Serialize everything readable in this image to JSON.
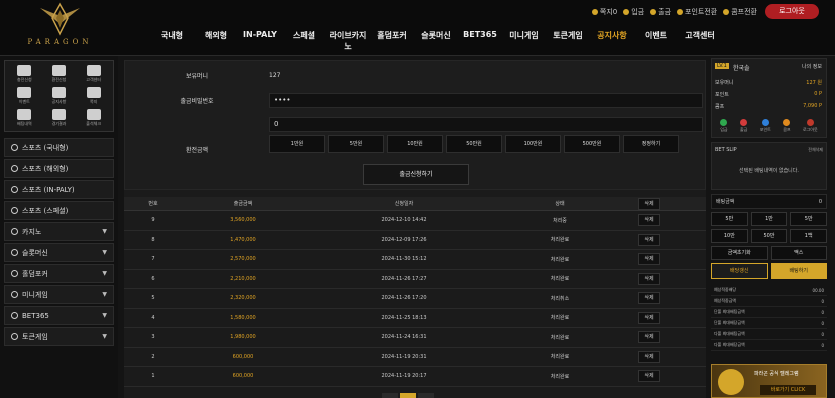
{
  "brand": {
    "logo_text": "PARAGON"
  },
  "top_links": [
    {
      "label": "쪽지0"
    },
    {
      "label": "입금"
    },
    {
      "label": "출금"
    },
    {
      "label": "포인트전환"
    },
    {
      "label": "콤프전환"
    }
  ],
  "logout_label": "로그아웃",
  "nav": [
    "국내형",
    "해외형",
    "IN-PALY",
    "스페셜",
    "라이브카지노",
    "홀덤포커",
    "슬롯머신",
    "BET365",
    "미니게임",
    "토큰게임",
    "공지사항",
    "이벤트",
    "고객센터"
  ],
  "nav_active_index": 10,
  "quick_menu": [
    "충전신청",
    "환전신청",
    "고객센터",
    "이벤트",
    "공지사항",
    "쪽지",
    "배팅내역",
    "경기결과",
    "출석체크"
  ],
  "side_menu": [
    {
      "label": "스포츠 (국내형)",
      "chevron": false
    },
    {
      "label": "스포츠 (해외형)",
      "chevron": false
    },
    {
      "label": "스포츠 (IN-PALY)",
      "chevron": false
    },
    {
      "label": "스포츠 (스페셜)",
      "chevron": false
    },
    {
      "label": "카지노",
      "chevron": true
    },
    {
      "label": "슬롯머신",
      "chevron": true
    },
    {
      "label": "홀덤포커",
      "chevron": true
    },
    {
      "label": "미니게임",
      "chevron": true
    },
    {
      "label": "BET365",
      "chevron": true
    },
    {
      "label": "토큰게임",
      "chevron": true
    }
  ],
  "form": {
    "balance_label": "보유머니",
    "balance_value": "127",
    "password_label": "출금비밀번호",
    "password_value": "••••",
    "amount_label": "환전금액",
    "amount_value": "0",
    "amount_buttons": [
      "1만원",
      "5만원",
      "10만원",
      "50만원",
      "100만원",
      "500만원",
      "정정하기"
    ],
    "submit_label": "출금신청하기"
  },
  "table": {
    "headers": [
      "번호",
      "출금금액",
      "신청일자",
      "상태",
      "삭제"
    ],
    "rows": [
      {
        "no": "9",
        "amount": "3,560,000",
        "date": "2024-12-10 14:42",
        "status": "처리중",
        "del": "삭제",
        "gold": true
      },
      {
        "no": "8",
        "amount": "1,470,000",
        "date": "2024-12-09 17:26",
        "status": "처리완료",
        "del": "삭제",
        "gold": true
      },
      {
        "no": "7",
        "amount": "2,570,000",
        "date": "2024-11-30 15:12",
        "status": "처리완료",
        "del": "삭제",
        "gold": true
      },
      {
        "no": "6",
        "amount": "2,210,000",
        "date": "2024-11-26 17:27",
        "status": "처리완료",
        "del": "삭제",
        "gold": true
      },
      {
        "no": "5",
        "amount": "2,320,000",
        "date": "2024-11-26 17:20",
        "status": "처리취소",
        "del": "삭제",
        "gold": true
      },
      {
        "no": "4",
        "amount": "1,580,000",
        "date": "2024-11-25 18:13",
        "status": "처리완료",
        "del": "삭제",
        "gold": true
      },
      {
        "no": "3",
        "amount": "1,980,000",
        "date": "2024-11-24 16:31",
        "status": "처리완료",
        "del": "삭제",
        "gold": true
      },
      {
        "no": "2",
        "amount": "600,000",
        "date": "2024-11-19 20:31",
        "status": "처리완료",
        "del": "삭제",
        "gold": true
      },
      {
        "no": "1",
        "amount": "600,000",
        "date": "2024-11-19 20:17",
        "status": "처리완료",
        "del": "삭제",
        "gold": true
      }
    ]
  },
  "user": {
    "level": "LV.1",
    "name": "한국솔",
    "links": "나의  정보",
    "money_label": "보유머니",
    "money_value": "127 원",
    "point_label": "포인트",
    "point_value": "0 P",
    "comp_label": "콤프",
    "comp_value": "7,090 P",
    "buttons": [
      {
        "label": "입금",
        "color": "#2fa84f"
      },
      {
        "label": "출금",
        "color": "#d23b3b"
      },
      {
        "label": "포인트",
        "color": "#2f7fd8"
      },
      {
        "label": "콤프",
        "color": "#e08a1e"
      },
      {
        "label": "로그아웃",
        "color": "#c0392b"
      }
    ]
  },
  "betslip": {
    "title": "BET SLIP",
    "delete_all": "전체삭제",
    "empty_msg": "선택된 배팅내역이 없습니다.",
    "bet_amount_label": "배팅금액",
    "bet_amount_value": "0",
    "chips": [
      "5만",
      "1만",
      "5만",
      "10만",
      "50만",
      "1백"
    ],
    "chips2": [
      "금액초기화",
      "맥스"
    ],
    "clear_label": "배당갱신",
    "bet_label": "배팅하기",
    "stats": [
      {
        "label": "예상적중배당",
        "value": "00.00"
      },
      {
        "label": "예상적중금액",
        "value": "0"
      },
      {
        "label": "단폴 최대배팅금액",
        "value": "0"
      },
      {
        "label": "단폴 최대배당금액",
        "value": "0"
      },
      {
        "label": "다폴 최대배팅금액",
        "value": "0"
      },
      {
        "label": "다폴 최대배당금액",
        "value": "0"
      }
    ]
  },
  "banner": {
    "title": "파라곤 공식 텔레그램",
    "button": "바로가기 CLICK"
  }
}
